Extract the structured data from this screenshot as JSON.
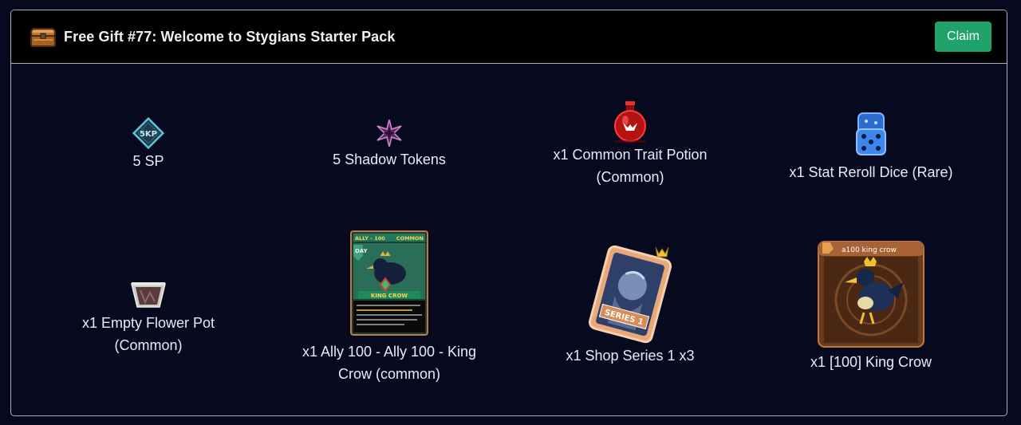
{
  "gift": {
    "title": "Free Gift #77: Welcome to Stygians Starter Pack",
    "claim_label": "Claim",
    "icon": "treasure-chest-icon"
  },
  "items": [
    {
      "label": "5 SP",
      "icon": "sp-diamond-icon",
      "icon_text": "5KP"
    },
    {
      "label": "5 Shadow Tokens",
      "icon": "shadow-token-star-icon"
    },
    {
      "label": "x1 Common Trait Potion (Common)",
      "icon": "red-potion-icon"
    },
    {
      "label": "x1 Stat Reroll Dice (Rare)",
      "icon": "blue-dice-icon"
    },
    {
      "label": "x1 Empty Flower Pot (Common)",
      "icon": "flower-pot-icon"
    },
    {
      "label": "x1 Ally 100 - Ally 100 - King Crow (common)",
      "icon": "ally-card-icon",
      "card": {
        "header": "ALLY - 100",
        "rarity": "COMMON",
        "tag": "DAY",
        "name": "KING CROW"
      }
    },
    {
      "label": "x1 Shop Series 1 x3",
      "icon": "series-card-icon",
      "card": {
        "text": "SERIES 1"
      }
    },
    {
      "label": "x1 [100] King Crow",
      "icon": "king-crow-portrait-icon",
      "card": {
        "name": "a100 king crow"
      }
    }
  ],
  "colors": {
    "background": "#070a1e",
    "header": "#000000",
    "border": "#a8adc8",
    "claim": "#1fa36b"
  }
}
